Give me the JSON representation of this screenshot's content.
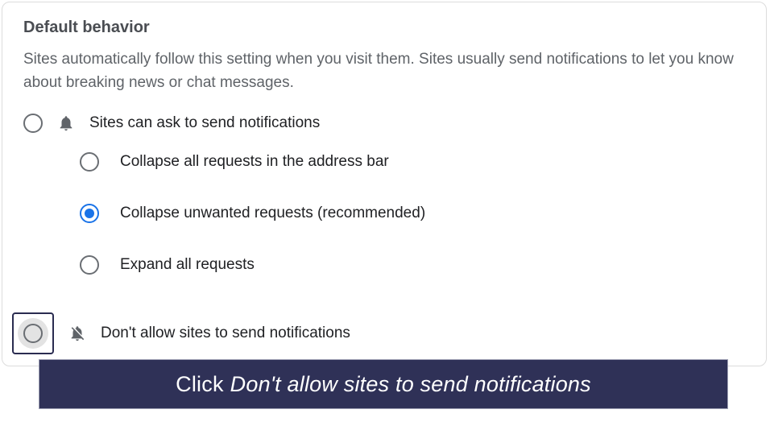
{
  "section": {
    "title": "Default behavior",
    "description": "Sites automatically follow this setting when you visit them. Sites usually send notifications to let you know about breaking news or chat messages."
  },
  "options": {
    "ask": {
      "label": "Sites can ask to send notifications"
    },
    "block": {
      "label": "Don't allow sites to send notifications"
    }
  },
  "sub_options": {
    "collapse_all": {
      "label": "Collapse all requests in the address bar"
    },
    "collapse_unwanted": {
      "label": "Collapse unwanted requests (recommended)"
    },
    "expand_all": {
      "label": "Expand all requests"
    }
  },
  "instruction": {
    "prefix": "Click",
    "action": "Don't allow sites to send notifications"
  }
}
